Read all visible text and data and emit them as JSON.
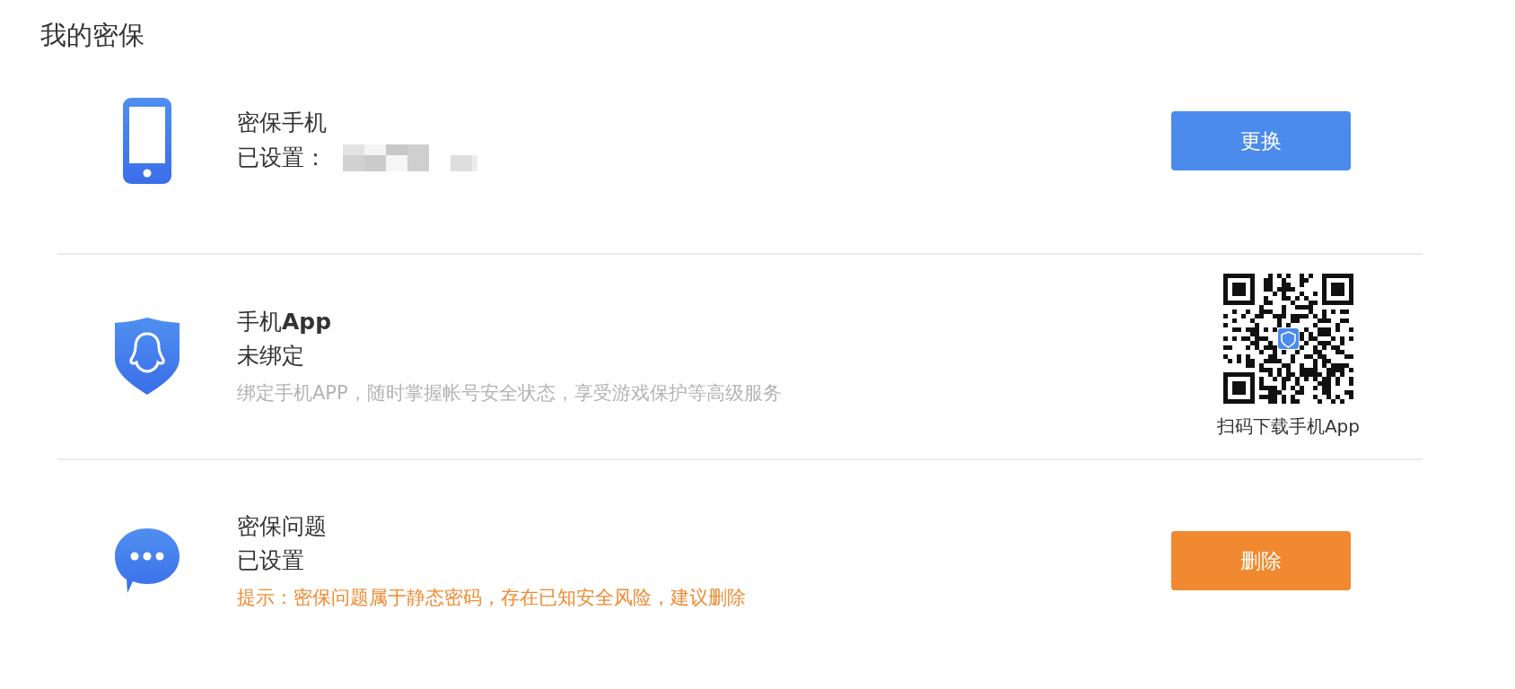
{
  "title": "我的密保",
  "items": [
    {
      "kind": "button",
      "name": "密保手机",
      "status": "已设置：",
      "masked": true,
      "action": {
        "label": "更换"
      }
    },
    {
      "kind": "qr",
      "name": "手机**App**",
      "status": "未绑定",
      "hint": {
        "text": "绑定手机APP，随时掌握帐号安全状态，享受游戏保护等高级服务"
      },
      "qr": {
        "caption": "扫码下载手机App"
      }
    },
    {
      "kind": "button",
      "name": "密保问题",
      "status": "已设置",
      "hint": {
        "text": "提示：密保问题属于静态密码，存在已知安全风险，建议删除"
      },
      "action": {
        "label": "删除"
      }
    }
  ]
}
